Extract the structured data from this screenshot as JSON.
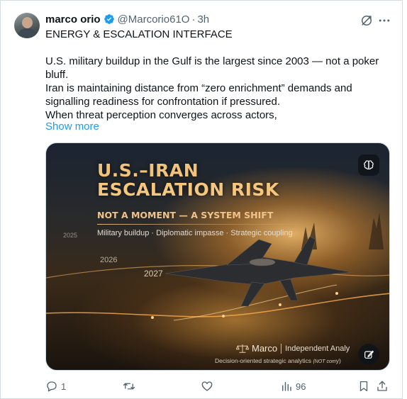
{
  "post": {
    "author": {
      "display_name": "marco orio",
      "handle": "@Marcorio61O",
      "separator": "·",
      "time": "3h",
      "verified": true,
      "avatar": "profile-photo"
    },
    "text": {
      "heading": "ENERGY & ESCALATION INTERFACE",
      "paragraph_1": "U.S. military buildup in the Gulf is the largest since 2003 — not a poker bluff.",
      "paragraph_2": "Iran is maintaining distance from “zero enrichment” demands and signalling readiness for confrontation if pressured.",
      "paragraph_3": "When threat perception converges across actors,"
    },
    "show_more": "Show more",
    "header_icons": [
      "grok-icon",
      "more-icon"
    ]
  },
  "media": {
    "title_line_1": "U.S.–IRAN",
    "title_line_2": "ESCALATION RISK",
    "subtitle": "NOT A MOMENT — A SYSTEM SHIFT",
    "tags": "Military buildup · Diplomatic impasse · Strategic coupling",
    "years": [
      "2025",
      "2026",
      "2027"
    ],
    "brand_name": "Marco",
    "brand_tag": "Independent Analy",
    "caption": "Decision-oriented strategic analytics",
    "caption_small": "(NOT com",
    "caption_tail": "y)",
    "icons": [
      "brain-icon",
      "edit-image-icon",
      "scales-icon"
    ]
  },
  "actions": {
    "reply_count": "1",
    "repost_count": "",
    "like_count": "",
    "views_count": "96",
    "icons": [
      "reply-icon",
      "repost-icon",
      "like-icon",
      "views-icon",
      "bookmark-icon",
      "share-icon"
    ]
  },
  "colors": {
    "link": "#1d9bf0",
    "verified": "#1d9bf0",
    "muted": "#536471",
    "text": "#0f1419",
    "title_gold": "#f1c27a"
  }
}
